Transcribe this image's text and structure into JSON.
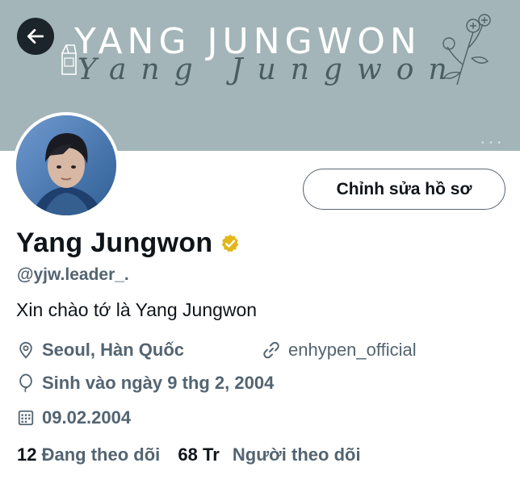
{
  "header": {
    "banner_title": "YANG JUNGWON",
    "banner_script": "Yang Jungwon"
  },
  "profile": {
    "edit_button_label": "Chỉnh sửa hồ sơ",
    "display_name": "Yang Jungwon",
    "handle": "@yjw.leader_.",
    "bio": "Xin chào tớ là Yang Jungwon",
    "location": "Seoul, Hàn Quốc",
    "website": "enhypen_official",
    "birthday": "Sinh vào ngày 9 thg 2, 2004",
    "joined": "09.02.2004",
    "following_count": "12",
    "following_label": "Đang theo dõi",
    "followers_count": "68 Tr",
    "followers_label": "Người theo dõi"
  },
  "icons": {
    "back": "arrow-left-icon",
    "verified": "verified-badge-icon",
    "location": "location-pin-icon",
    "website": "link-icon",
    "birthday": "balloon-icon",
    "joined": "calendar-icon"
  },
  "colors": {
    "banner": "#a3b5b9",
    "verified_badge": "#e2b719",
    "text_primary": "#0f1419",
    "text_secondary": "#536471"
  }
}
